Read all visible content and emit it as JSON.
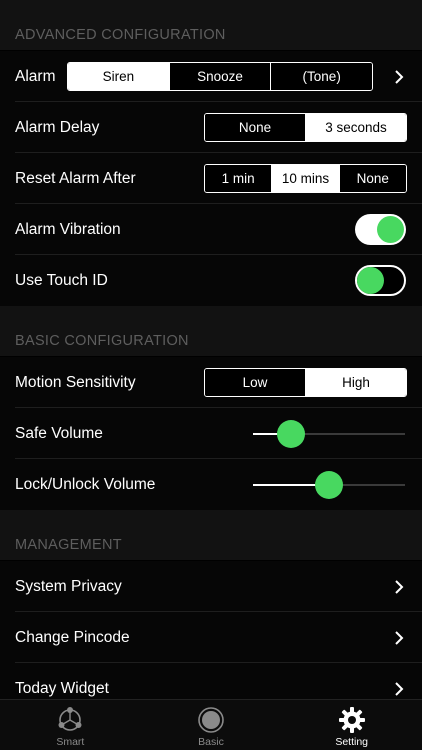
{
  "sections": {
    "advanced": "ADVANCED CONFIGURATION",
    "basic": "BASIC CONFIGURATION",
    "management": "MANAGEMENT"
  },
  "alarm": {
    "label": "Alarm",
    "options": [
      "Siren",
      "Snooze",
      "(Tone)"
    ],
    "selected": "Siren"
  },
  "alarm_delay": {
    "label": "Alarm Delay",
    "options": [
      "None",
      "3 seconds"
    ],
    "selected": "3 seconds"
  },
  "reset_alarm": {
    "label": "Reset Alarm After",
    "options": [
      "1 min",
      "10 mins",
      "None"
    ],
    "selected": "10 mins"
  },
  "alarm_vibration": {
    "label": "Alarm Vibration",
    "on": true
  },
  "touch_id": {
    "label": "Use Touch ID",
    "on": false
  },
  "motion": {
    "label": "Motion Sensitivity",
    "options": [
      "Low",
      "High"
    ],
    "selected": "High"
  },
  "safe_volume": {
    "label": "Safe Volume",
    "value": 0.25
  },
  "lock_volume": {
    "label": "Lock/Unlock Volume",
    "value": 0.5
  },
  "management": {
    "items": [
      "System Privacy",
      "Change Pincode",
      "Today Widget"
    ]
  },
  "tabs": [
    {
      "label": "Smart",
      "icon": "smart-network-icon",
      "active": false
    },
    {
      "label": "Basic",
      "icon": "basic-circle-icon",
      "active": false
    },
    {
      "label": "Setting",
      "icon": "gear-icon",
      "active": true
    }
  ],
  "colors": {
    "accent": "#48d860",
    "background": "#000000",
    "section_bg": "#121212"
  }
}
